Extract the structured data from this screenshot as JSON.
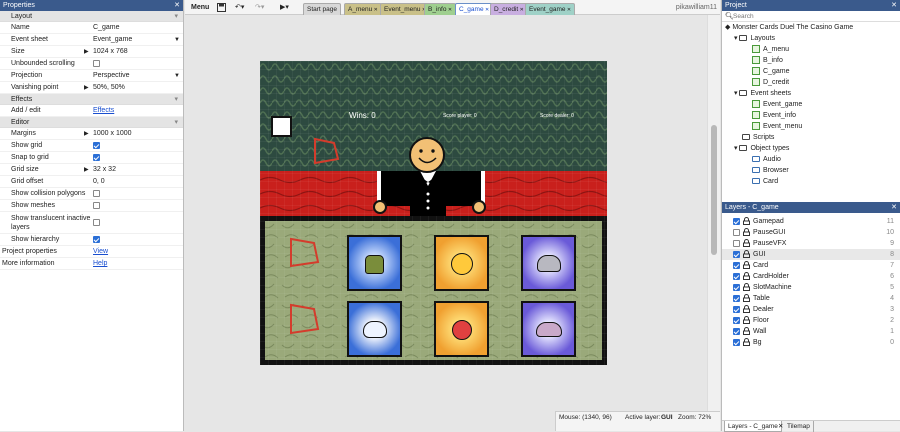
{
  "properties": {
    "title": "Properties",
    "close": "✕",
    "sections": {
      "layout": "Layout",
      "effects": "Effects",
      "editor": "Editor"
    },
    "rows": [
      {
        "label": "Name",
        "value": "C_game"
      },
      {
        "label": "Event sheet",
        "value": "Event_game"
      },
      {
        "label": "Size",
        "value": "1024 x 768"
      },
      {
        "label": "Unbounded scrolling",
        "checked": false
      },
      {
        "label": "Projection",
        "value": "Perspective"
      },
      {
        "label": "Vanishing point",
        "value": "50%, 50%"
      }
    ],
    "effects_row": {
      "label": "Add / edit",
      "value": "Effects"
    },
    "editor_rows": [
      {
        "label": "Margins",
        "value": "1000 x 1000"
      },
      {
        "label": "Show grid",
        "checked": true
      },
      {
        "label": "Snap to grid",
        "checked": true
      },
      {
        "label": "Grid size",
        "value": "32 x 32"
      },
      {
        "label": "Grid offset",
        "value": "0, 0"
      },
      {
        "label": "Show collision polygons",
        "checked": false
      },
      {
        "label": "Show meshes",
        "checked": false
      },
      {
        "label": "Show translucent inactive layers",
        "checked": false
      },
      {
        "label": "Show hierarchy",
        "checked": true
      }
    ],
    "project_properties": {
      "label": "Project properties",
      "value": "View"
    },
    "more_info": {
      "label": "More information",
      "value": "Help"
    }
  },
  "toolbar": {
    "menu": "Menu",
    "user": "pikawilliam11",
    "tabs": [
      {
        "label": "Start page",
        "color": "#d8d8d8",
        "active": false
      },
      {
        "label": "A_menu",
        "color": "#c9c088",
        "active": false
      },
      {
        "label": "Event_menu",
        "color": "#c9c088",
        "active": false
      },
      {
        "label": "B_info",
        "color": "#9fcf8f",
        "active": false
      },
      {
        "label": "C_game",
        "color": "#bcd6f0",
        "active": true
      },
      {
        "label": "D_credit",
        "color": "#c8aee0",
        "active": false
      },
      {
        "label": "Event_game",
        "color": "#9fd1c7",
        "active": false
      }
    ]
  },
  "game": {
    "wins": "Wins: 0",
    "score_player": "Score player: 0",
    "score_dealer": "Score dealer: 0",
    "card_colors": [
      "#3b6fd8",
      "#f0a030",
      "#6a5ad8",
      "#3b6fd8",
      "#f0a030",
      "#6a5ad8"
    ]
  },
  "status": {
    "mouse": "Mouse: (1340, 96)",
    "active_layer_label": "Active layer:",
    "active_layer": "GUI",
    "zoom": "Zoom: 72%"
  },
  "project": {
    "title": "Project",
    "search_placeholder": "Search",
    "root": "Monster Cards Duel The Casino Game",
    "layouts_label": "Layouts",
    "layouts": [
      "A_menu",
      "B_info",
      "C_game",
      "D_credit"
    ],
    "event_sheets_label": "Event sheets",
    "event_sheets": [
      "Event_game",
      "Event_info",
      "Event_menu"
    ],
    "scripts_label": "Scripts",
    "object_types_label": "Object types",
    "object_types": [
      "Audio",
      "Browser",
      "Card"
    ]
  },
  "layers": {
    "title": "Layers - C_game",
    "items": [
      {
        "name": "Gamepad",
        "num": "11",
        "checked": true
      },
      {
        "name": "PauseGUI",
        "num": "10",
        "checked": false
      },
      {
        "name": "PauseVFX",
        "num": "9",
        "checked": false
      },
      {
        "name": "GUI",
        "num": "8",
        "checked": true
      },
      {
        "name": "Card",
        "num": "7",
        "checked": true
      },
      {
        "name": "CardHolder",
        "num": "6",
        "checked": true
      },
      {
        "name": "SlotMachine",
        "num": "5",
        "checked": true
      },
      {
        "name": "Table",
        "num": "4",
        "checked": true
      },
      {
        "name": "Dealer",
        "num": "3",
        "checked": true
      },
      {
        "name": "Floor",
        "num": "2",
        "checked": true
      },
      {
        "name": "Wall",
        "num": "1",
        "checked": true
      },
      {
        "name": "Bg",
        "num": "0",
        "checked": true
      }
    ],
    "bottom_tabs": [
      "Layers - C_game",
      "Tilemap"
    ]
  }
}
